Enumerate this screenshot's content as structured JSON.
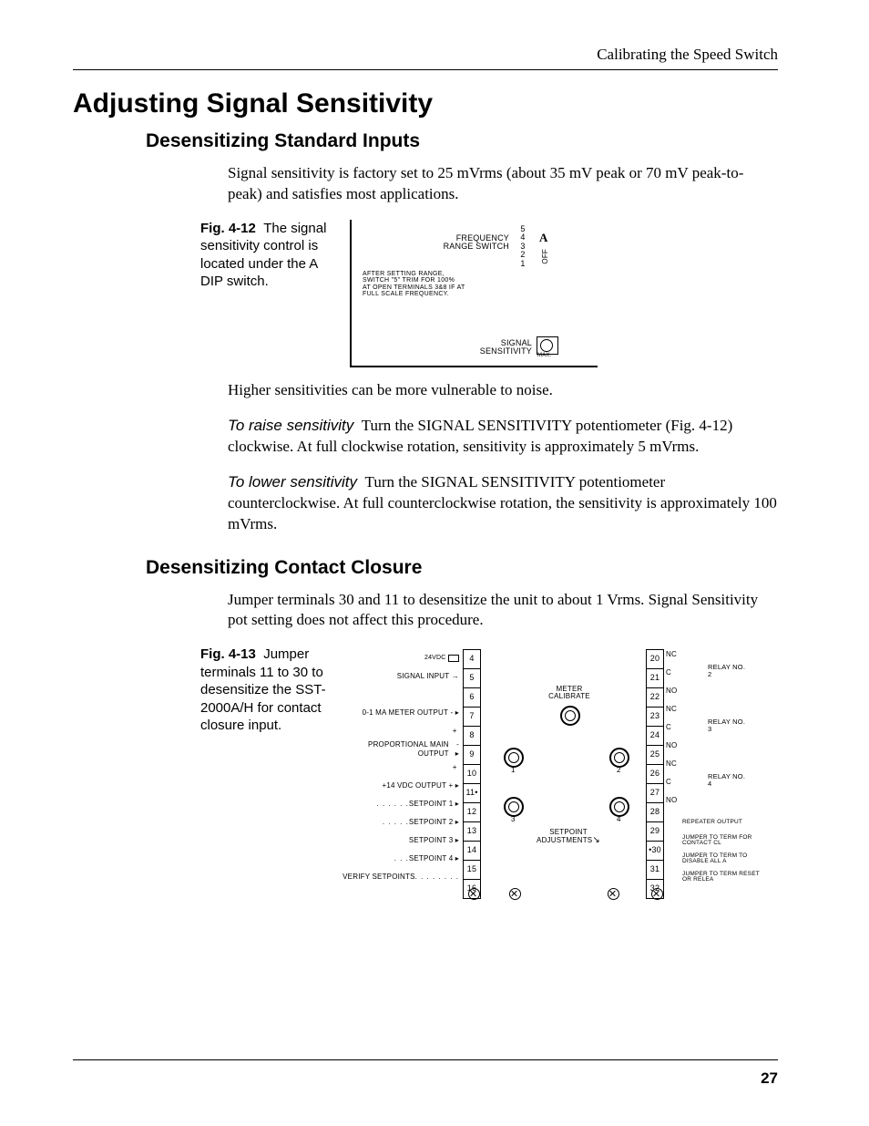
{
  "header": {
    "running_head": "Calibrating the Speed Switch"
  },
  "h1": "Adjusting Signal Sensitivity",
  "sec1": {
    "title": "Desensitizing Standard Inputs",
    "p1": "Signal sensitivity is factory set to 25 mVrms (about 35 mV peak or 70 mV peak-to-peak) and satisfies most applications.",
    "fig": {
      "num": "Fig. 4-12",
      "caption": "The signal sensitivity control is located under the A DIP switch.",
      "freq_label_1": "FREQUENCY",
      "freq_label_2": "RANGE SWITCH",
      "dip": [
        "5",
        "4",
        "3",
        "2",
        "1"
      ],
      "colA": "A",
      "colOFF": "OFF",
      "note_l1": "AFTER SETTING RANGE,",
      "note_l2": "SWITCH \"5\" TRIM FOR 100%",
      "note_l3": "AT OPEN TERMINALS 3&8 IF AT",
      "note_l4": "FULL SCALE FREQUENCY.",
      "sig_l1": "SIGNAL",
      "sig_l2": "SENSITIVITY",
      "max": "MAX."
    },
    "p2": "Higher sensitivities can be more vulnerable to noise.",
    "raise_label": "To raise sensitivity",
    "raise_text": "Turn the SIGNAL SENSITIVITY potentiometer (Fig. 4-12) clockwise. At full clockwise rotation, sensitivity is approximately 5 mVrms.",
    "lower_label": "To lower sensitivity",
    "lower_text": "Turn the SIGNAL SENSITIVITY potentiometer counterclockwise. At full counterclockwise rotation, the sensitivity is approximately 100 mVrms."
  },
  "sec2": {
    "title": "Desensitizing Contact Closure",
    "p1": "Jumper terminals 30 and 11 to desensitize the unit to about 1 Vrms. Signal Sensitivity pot setting does not affect this procedure.",
    "fig": {
      "num": "Fig. 4-13",
      "caption": "Jumper terminals 11 to 30 to desensitize the SST-2000A/H for contact closure input.",
      "left_labels": [
        "24VDC",
        "SIGNAL INPUT",
        "",
        "0-1 MA METER OUTPUT",
        "",
        "PROPORTIONAL MAIN OUTPUT",
        "",
        "+14 VDC OUTPUT",
        "SETPOINT 1",
        "SETPOINT 2",
        "SETPOINT 3",
        "SETPOINT 4",
        "VERIFY SETPOINTS"
      ],
      "left_terms": [
        "4",
        "5",
        "6",
        "7",
        "8",
        "9",
        "10",
        "11•",
        "12",
        "13",
        "14",
        "15",
        "16"
      ],
      "right_terms": [
        "20",
        "21",
        "22",
        "23",
        "24",
        "25",
        "26",
        "27",
        "28",
        "29",
        "•30",
        "31",
        "32"
      ],
      "mid_symbols": [
        "NC",
        "C",
        "NO",
        "NC",
        "C",
        "NO",
        "NC",
        "C",
        "NO",
        "",
        "",
        "",
        ""
      ],
      "relay2": "RELAY NO. 2",
      "relay3": "RELAY NO. 3",
      "relay4": "RELAY NO. 4",
      "right_labels": [
        "",
        "",
        "",
        "",
        "",
        "",
        "",
        "",
        "",
        "REPEATER OUTPUT",
        "JUMPER TO TERM FOR CONTACT CL",
        "JUMPER TO TERM TO DISABLE ALL A",
        "JUMPER TO TERM RESET OR RELEA"
      ],
      "meter": "METER CALIBRATE",
      "setpoint": "SETPOINT ADJUSTMENTS",
      "pot_nums": {
        "tl": "1",
        "tr": "2",
        "bl": "3",
        "br": "4"
      }
    }
  },
  "page_number": "27"
}
